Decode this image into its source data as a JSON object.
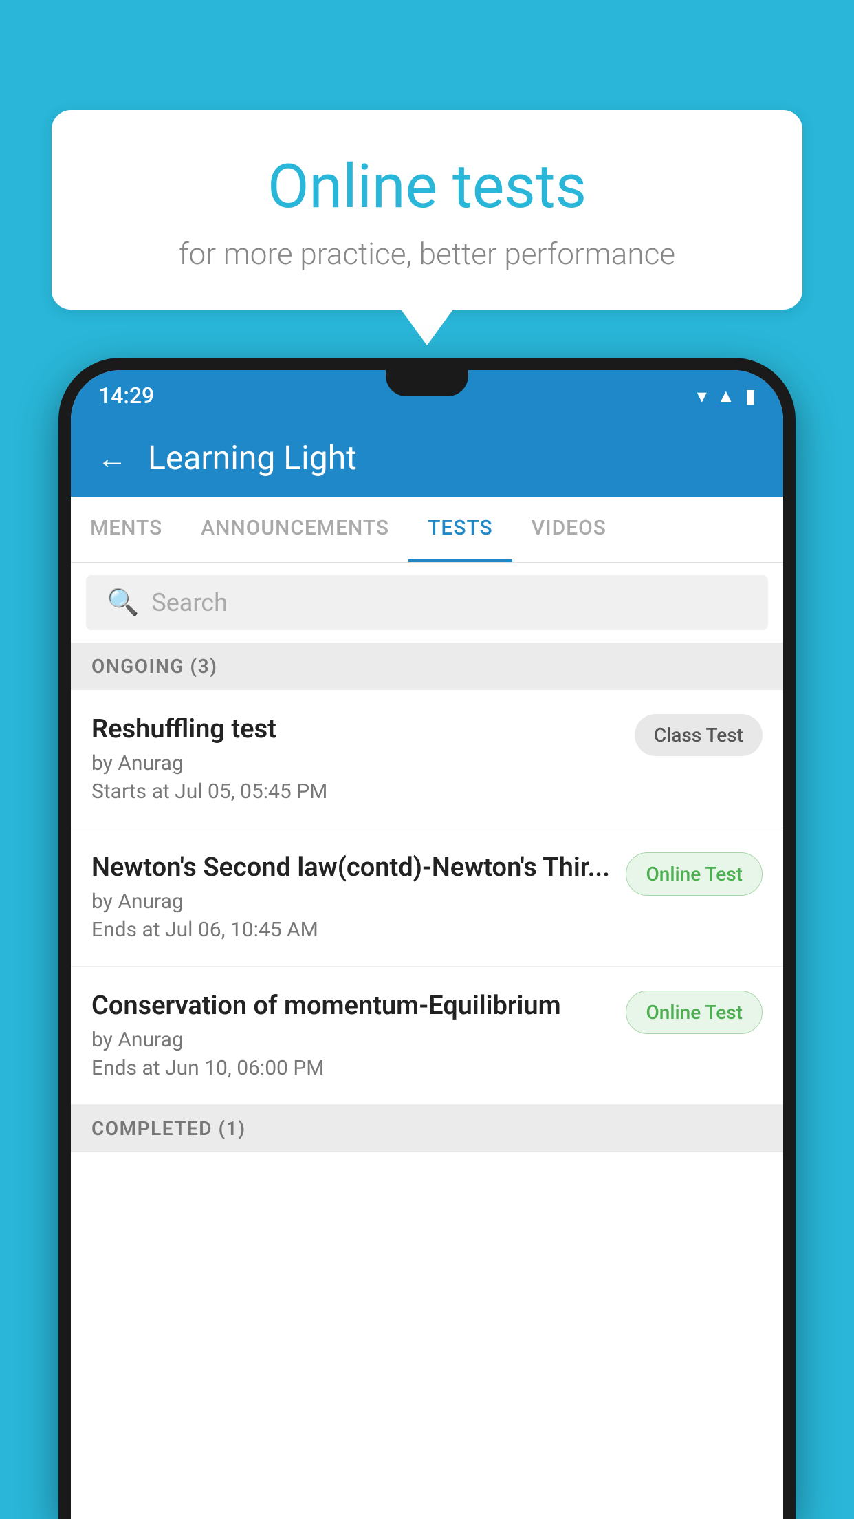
{
  "background_color": "#29b6d8",
  "speech_bubble": {
    "title": "Online tests",
    "subtitle": "for more practice, better performance"
  },
  "phone": {
    "status_bar": {
      "time": "14:29",
      "icons": [
        "wifi",
        "signal",
        "battery"
      ]
    },
    "app_bar": {
      "title": "Learning Light"
    },
    "tabs": [
      {
        "label": "MENTS",
        "active": false
      },
      {
        "label": "ANNOUNCEMENTS",
        "active": false
      },
      {
        "label": "TESTS",
        "active": true
      },
      {
        "label": "VIDEOS",
        "active": false
      }
    ],
    "search": {
      "placeholder": "Search"
    },
    "ongoing_section": {
      "label": "ONGOING (3)"
    },
    "tests": [
      {
        "name": "Reshuffling test",
        "author": "by Anurag",
        "date": "Starts at  Jul 05, 05:45 PM",
        "badge": "Class Test",
        "badge_type": "class"
      },
      {
        "name": "Newton's Second law(contd)-Newton's Thir...",
        "author": "by Anurag",
        "date": "Ends at  Jul 06, 10:45 AM",
        "badge": "Online Test",
        "badge_type": "online"
      },
      {
        "name": "Conservation of momentum-Equilibrium",
        "author": "by Anurag",
        "date": "Ends at  Jun 10, 06:00 PM",
        "badge": "Online Test",
        "badge_type": "online"
      }
    ],
    "completed_section": {
      "label": "COMPLETED (1)"
    }
  }
}
